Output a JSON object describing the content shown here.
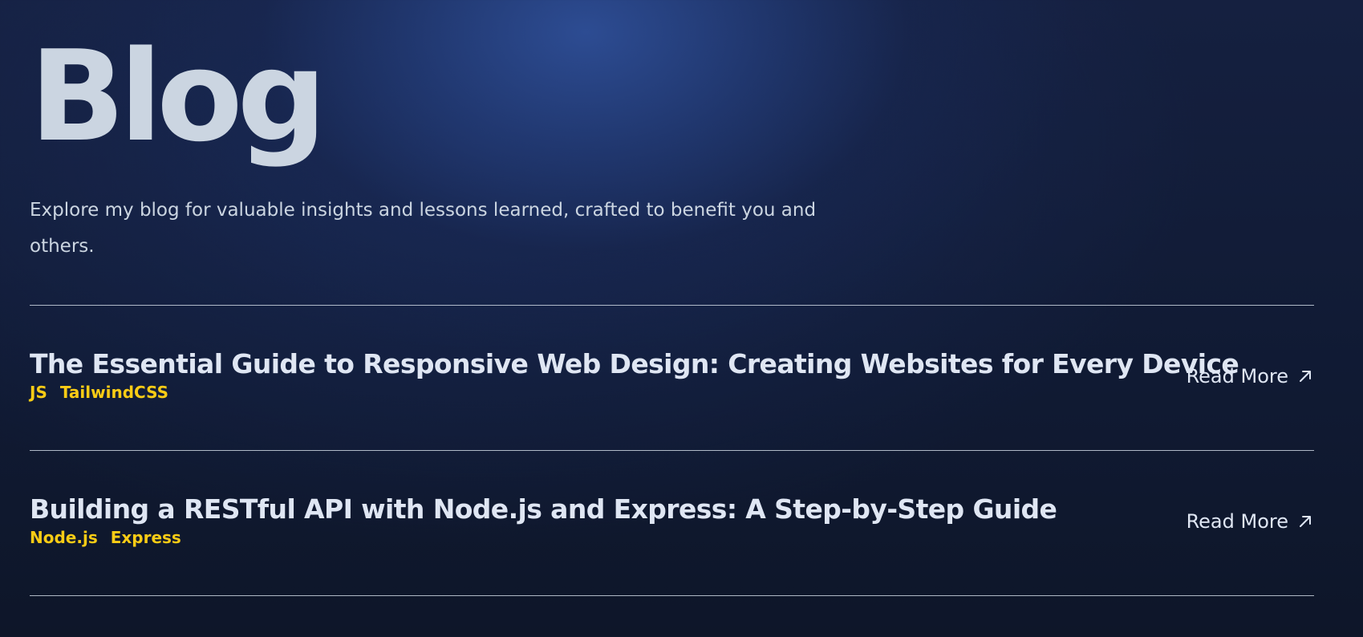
{
  "header": {
    "title": "Blog",
    "intro": "Explore my blog for valuable insights and lessons learned, crafted to benefit you and others."
  },
  "posts": [
    {
      "title": "The Essential Guide to Responsive Web Design: Creating Websites for Every Device",
      "tags": [
        "JS",
        "TailwindCSS"
      ],
      "link_label": "Read More",
      "link_icon": "arrow-up-right-icon"
    },
    {
      "title": "Building a RESTful API with Node.js and Express: A Step-by-Step Guide",
      "tags": [
        "Node.js",
        "Express"
      ],
      "link_label": "Read More",
      "link_icon": "arrow-up-right-icon"
    }
  ],
  "colors": {
    "tag": "#facc15",
    "text": "#dfe6f3",
    "background": "#0f172a"
  }
}
